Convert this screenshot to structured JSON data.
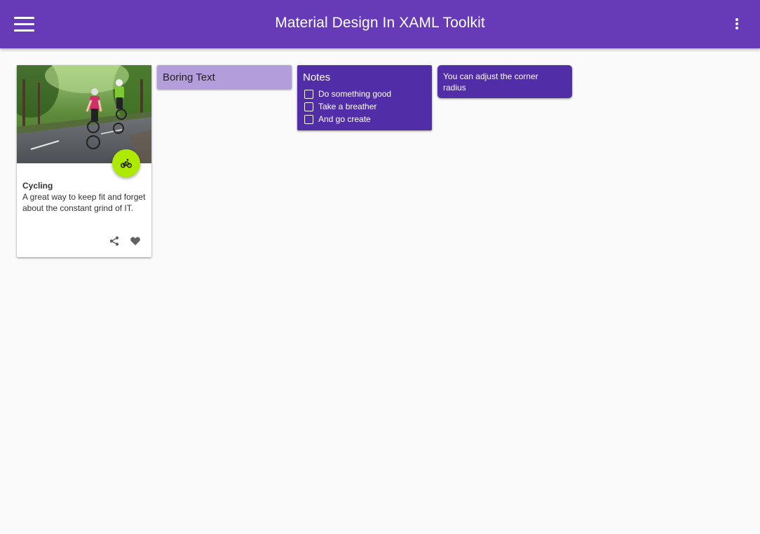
{
  "app_bar": {
    "title": "Material Design In XAML Toolkit",
    "background": "#673ab7",
    "menu_icon": "hamburger-menu-icon",
    "overflow_icon": "dots-vertical-icon"
  },
  "cards": {
    "cycling": {
      "heading": "Cycling",
      "body": "A great way to keep fit and forget about the constant grind of IT.",
      "fab_icon": "bike-icon",
      "fab_color": "#aeea00",
      "actions": [
        "share-icon",
        "heart-icon"
      ]
    },
    "boring": {
      "text": "Boring Text",
      "background": "#b39ddb"
    },
    "notes": {
      "title": "Notes",
      "background": "#512da8",
      "items": [
        {
          "label": "Do something good",
          "checked": false
        },
        {
          "label": "Take a breather",
          "checked": false
        },
        {
          "label": "And go create",
          "checked": false
        }
      ]
    },
    "corner_radius": {
      "text": "You can adjust the corner radius",
      "background": "#512da8"
    }
  }
}
